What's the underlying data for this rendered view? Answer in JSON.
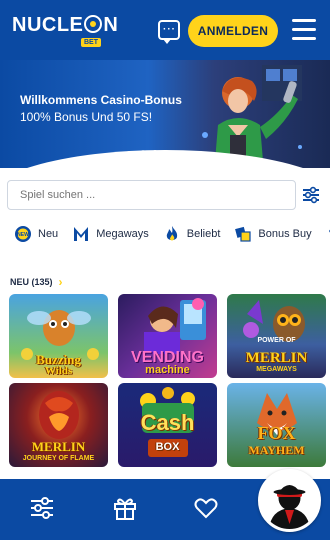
{
  "header": {
    "logo_text_a": "NUCLE",
    "logo_text_b": "N",
    "logo_badge": "BET",
    "login_label": "ANMELDEN",
    "bg_color": "#0b4aa3",
    "accent_color": "#ffd31a"
  },
  "banner": {
    "title": "Willkommens Casino-Bonus",
    "subtitle": "100% Bonus Und 50 FS!",
    "slide_count": 3,
    "active_slide": 1
  },
  "search": {
    "placeholder": "Spiel suchen ..."
  },
  "categories": [
    {
      "icon": "new-badge-icon",
      "label": "Neu"
    },
    {
      "icon": "megaways-m-icon",
      "label": "Megaways"
    },
    {
      "icon": "flame-icon",
      "label": "Beliebt"
    },
    {
      "icon": "bonus-buy-icon",
      "label": "Bonus Buy"
    }
  ],
  "section": {
    "title": "NEU (135)"
  },
  "games": [
    {
      "name_a": "Buzzing",
      "name_b": "Wilds"
    },
    {
      "name_a": "VENDING",
      "name_b": "machine"
    },
    {
      "name_pre": "POWER OF",
      "name_a": "MERLIN",
      "name_b": "MEGAWAYS"
    },
    {
      "name_a": "MERLIN",
      "name_b": "JOURNEY OF FLAME"
    },
    {
      "name_a": "Cash",
      "name_b": "BOX"
    },
    {
      "name_a": "FOX",
      "name_b": "MAYHEM"
    }
  ],
  "bottom_nav": [
    {
      "icon": "sliders-icon"
    },
    {
      "icon": "gift-icon"
    },
    {
      "icon": "heart-icon"
    }
  ]
}
